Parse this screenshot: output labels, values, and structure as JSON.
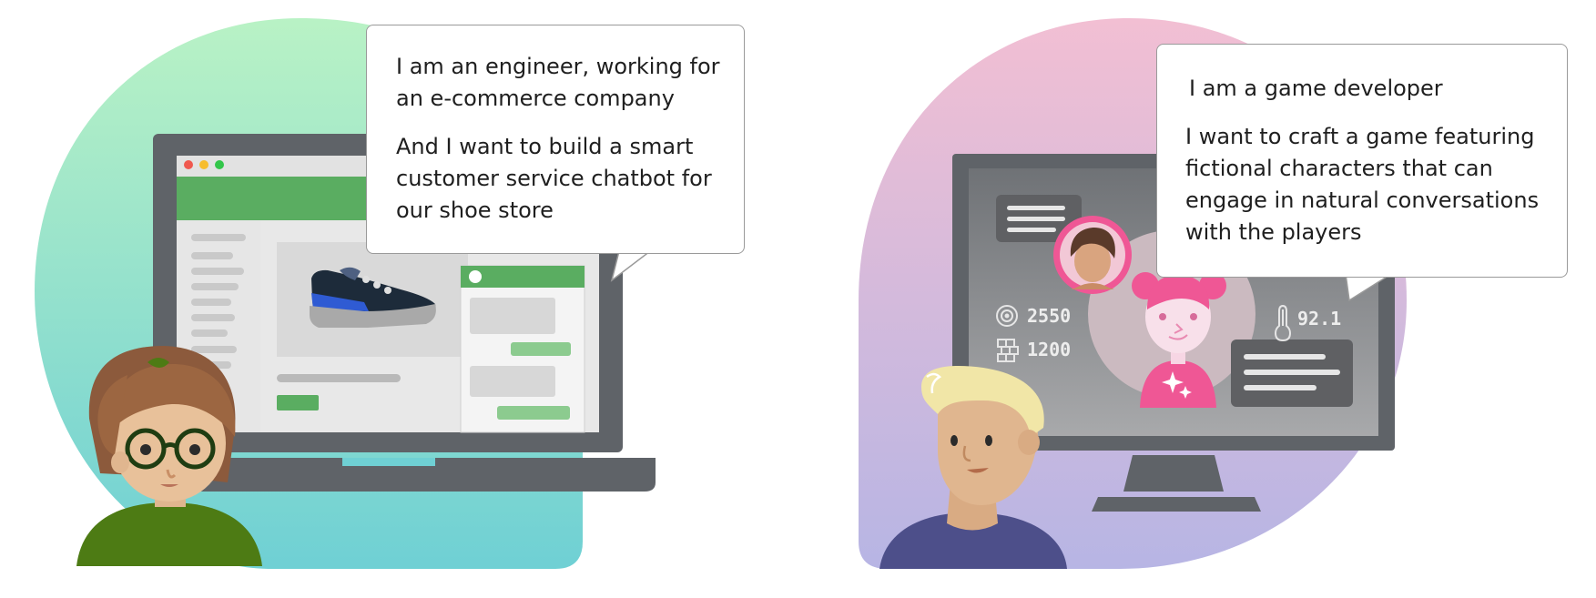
{
  "colors": {
    "left_bg_top": "#b9f2c5",
    "left_bg_bottom": "#6fd0d4",
    "right_bg_top": "#f2bfd3",
    "right_bg_bottom": "#b7b5e4",
    "store_green": "#5aad61",
    "accent_pink": "#ef5795",
    "device_gray": "#5f6368"
  },
  "left_scene": {
    "speech_line_1": "I am an engineer, working for an e-commerce company",
    "speech_line_2": "And I want to build a smart customer service chatbot for our shoe store"
  },
  "right_scene": {
    "speech_line_1": "I am a game developer",
    "speech_line_2": "I want to craft a game featuring fictional characters that can engage in natural conversations with the players",
    "stats": {
      "score": "2550",
      "blocks": "1200",
      "temperature": "92.1"
    }
  },
  "icons": [
    "target-icon",
    "blocks-icon",
    "thermometer-icon",
    "sparkle-icon",
    "shoe-icon"
  ]
}
